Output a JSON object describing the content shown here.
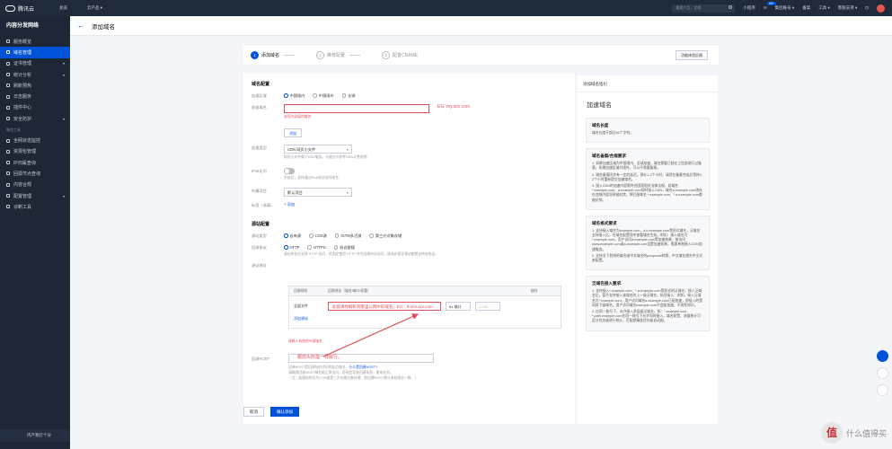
{
  "topbar": {
    "brand": "腾讯云",
    "home": "总览",
    "products": "云产品 ▾",
    "search_placeholder": "搜索产品、文档",
    "mini_program": "小程序",
    "messages_badge": "99+",
    "account": "集团账号 ▾",
    "ticket": "备案",
    "tools": "工具 ▾",
    "support": "客服支持 ▾"
  },
  "sidebar": {
    "title": "内容分发网络",
    "items": [
      {
        "label": "服务概览",
        "active": false
      },
      {
        "label": "域名管理",
        "active": true
      },
      {
        "label": "证书管理",
        "active": false,
        "chev": "▾"
      },
      {
        "label": "统计分析",
        "active": false,
        "chev": "▾"
      },
      {
        "label": "刷新预热",
        "active": false
      },
      {
        "label": "日志服务",
        "active": false
      },
      {
        "label": "插件中心",
        "active": false
      },
      {
        "label": "安全防护",
        "active": false,
        "chev": "▾"
      }
    ],
    "group_label": "服务工具",
    "tools": [
      {
        "label": "全网状态监控"
      },
      {
        "label": "资源包管理"
      },
      {
        "label": "IP归属查询"
      },
      {
        "label": "回源节点查询"
      },
      {
        "label": "内容合规"
      },
      {
        "label": "配置管理",
        "chev": "▾"
      },
      {
        "label": "诊断工具"
      }
    ],
    "bottom": "内产我打个分"
  },
  "header": {
    "back": "←",
    "title": "添加域名"
  },
  "steps": [
    {
      "n": "1",
      "label": "添加域名"
    },
    {
      "n": "2",
      "label": "推荐配置"
    },
    {
      "n": "3",
      "label": "配置CNAME"
    }
  ],
  "feedback_button": "功能体验反馈",
  "form": {
    "domain_section": "域名配置",
    "area_label": "加速区域",
    "area_options": [
      "中国境内",
      "中国境外",
      "全球"
    ],
    "domain_label": "加速域名",
    "domain_error": "该项为必填的域名",
    "domain_annotation": "EG: my.xxx.com",
    "add_label": "添加",
    "type_label": "加速类型",
    "type_value": "CDN 网页小文件",
    "type_hint": "网页小文件属于CDN服务，计量方式参考",
    "type_hint_link": "CDN计费说明",
    "ipv6_label": "IPv6访问",
    "ipv6_hint": "开启后，支持通过IPv6协议访问域名",
    "project_label": "所属项目",
    "project_value": "默认项目",
    "tag_label": "标签（选填）",
    "tag_add": "+ 添加",
    "origin_section": "源站配置",
    "origin_type_label": "源站类型",
    "origin_types": [
      "自有源",
      "COS源",
      "IGTM多活源",
      "第三方对象存储"
    ],
    "protocol_label": "回源协议",
    "protocols": [
      "HTTP",
      "HTTPS",
      "协议跟随"
    ],
    "protocol_hint": "源站的协议支持 HTTP 访问，将固定使用 HTTP 作为回源协议访问，请务必保证源站能够支持该协议。",
    "address_label": "源站地址",
    "table_headers": [
      "回源规则",
      "回源地址（域名/端口/权重）",
      "操作"
    ],
    "row_rule": "全部文件",
    "host_value": "此处填你解析到家里公网IP的域名，EG：home.xxx.com",
    "port_value": "81 端口",
    "port_placeholder": "1-100",
    "add_origin": "添加源站",
    "origin_error": "请输入有效的IP或域名",
    "host_label": "回源HOST",
    "host_annotation": "跟前头所指一样就行。",
    "host_hint": "回源HOST是回源站的访问的站点域名，",
    "host_hint_link": "什么是回源HOST?",
    "host_hint2": "请确保回源HOST域名能正常访问，否则会导致回源失败，影响业务。",
    "host_hint3": "（注：若源站地址为COS或第三方存储对象存储，则回源HOST需与源站地址一致。）"
  },
  "buttons": {
    "cancel": "取消",
    "submit": "确认添加"
  },
  "guide": {
    "header": "添加域名指引",
    "title": "加速域名",
    "boxes": [
      {
        "title": "域名长度",
        "lines": [
          "域名长度不超过81个字符。"
        ]
      },
      {
        "title": "域名备案/合规要求",
        "lines": [
          "1. 如果加速区域为中国境内、全球加速，域名需要已经在工信部进行过备案，如果加速区域为境外，可以不需要备案。",
          "2. 域名备案同步有一定的延迟，预计1-2个小时，请您在备案完成后等待1-2个小时重新提交加速域名。",
          "3. 接入CDN的加速内容需符合国家相关法律法规，若域名 *.example.com、a.example.com同时接入CDN，域名a.example.com则存在违规内容导致被封禁，将匹配域名 *.example.com、*.a.example.com都被封禁。"
        ]
      },
      {
        "title": "域名格式要求",
        "lines": [
          "1. 支持接入域名为example.com，a.b.example.com等形式域名，泛域名支持接入后，在域名配置项中查看域名生效，例如：接入域名为*.example.com，用户访问a.example.com等加速效果，前访问www.example.com或a.example.com设置加速效果，需要单独接入CDN加速服务。",
          "2. 支持全下划线的域名或中文域名的punycode转换，中文域名需先中文式来配置。"
        ]
      },
      {
        "title": "泛域名接入要求",
        "lines": [
          "1. 支持接入*.example.com、*.a.example.com等形式的泛域名，接入泛域名后，暂不支持接入该域名的上一级泛域名，指导接入：例如，接入泛域名为*.example.com，用户访问域名a.example.com已配加速，即接入的是同其下级域名，用户访问域名example.com不会配加速，不再免知识。",
          "2. 应同一账号下，允许接入多层级泛域名，如：*.example.com、*.path.example.com在同一账号下允许同时接入，域名配置、流量统计可区分优先级进行统计，匹配就精准优先级自动配。"
        ]
      }
    ]
  },
  "watermark": "什么值得买",
  "colors": {
    "accent": "#0052d9",
    "error": "#e34d59",
    "sidebar": "#1d2735",
    "topbar": "#1f2b3a"
  }
}
